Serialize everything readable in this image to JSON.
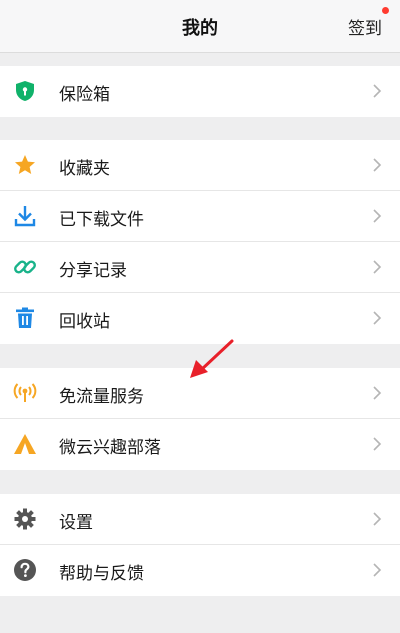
{
  "header": {
    "title": "我的",
    "signin": "签到"
  },
  "groups": [
    {
      "items": [
        {
          "label": "保险箱",
          "icon": "shield-lock-icon"
        }
      ]
    },
    {
      "items": [
        {
          "label": "收藏夹",
          "icon": "star-icon"
        },
        {
          "label": "已下载文件",
          "icon": "download-icon"
        },
        {
          "label": "分享记录",
          "icon": "link-icon"
        },
        {
          "label": "回收站",
          "icon": "trash-icon"
        }
      ]
    },
    {
      "items": [
        {
          "label": "免流量服务",
          "icon": "signal-icon"
        },
        {
          "label": "微云兴趣部落",
          "icon": "tent-icon"
        }
      ]
    },
    {
      "items": [
        {
          "label": "设置",
          "icon": "gear-icon"
        },
        {
          "label": "帮助与反馈",
          "icon": "help-icon"
        }
      ]
    }
  ],
  "colors": {
    "green": "#10b26a",
    "orange": "#f6a623",
    "blue": "#1e88e5",
    "teal": "#19b38a",
    "gray": "#555555",
    "red_arrow": "#e8202a",
    "badge_dot": "#ff3b30"
  }
}
